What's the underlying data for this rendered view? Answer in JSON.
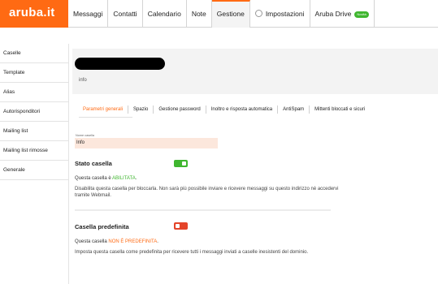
{
  "brand": {
    "logo": "aruba.it"
  },
  "topnav": {
    "tabs": [
      "Messaggi",
      "Contatti",
      "Calendario",
      "Note",
      "Gestione",
      "Impostazioni",
      "Aruba Drive"
    ],
    "active": "Gestione",
    "drive_badge": "Novità"
  },
  "sidebar": {
    "items": [
      "Caselle",
      "Template",
      "Alias",
      "Autorisponditori",
      "Mailing list",
      "Mailing list rimosse",
      "Generale"
    ]
  },
  "header": {
    "box_name": "info"
  },
  "subtabs": {
    "items": [
      "Parametri generali",
      "Spazio",
      "Gestione password",
      "Inoltro e risposta automatica",
      "AntiSpam",
      "Mittenti bloccati e sicuri"
    ],
    "active": "Parametri generali"
  },
  "form": {
    "name_label": "Nome casella",
    "name_value": "Info"
  },
  "status": {
    "title": "Stato casella",
    "line_prefix": "Questa casella è ",
    "line_value": "ABILITATA",
    "line_suffix": ".",
    "toggle_on": true,
    "desc": "Disabilita questa casella per bloccarla. Non sarà più possibile inviare e ricevere messaggi su questo indirizzo nè accedervi tramite Webmail."
  },
  "default": {
    "title": "Casella predefinita",
    "line_prefix": "Questa casella ",
    "line_value": "NON È PREDEFINITA",
    "line_suffix": ".",
    "toggle_on": false,
    "desc": "Imposta questa casella come predefinita per ricevere tutti i messaggi inviati a caselle inesistenti del dominio."
  },
  "colors": {
    "accent": "#ff6a13",
    "enabled": "#3fb62f",
    "disabled": "#e4442a"
  }
}
